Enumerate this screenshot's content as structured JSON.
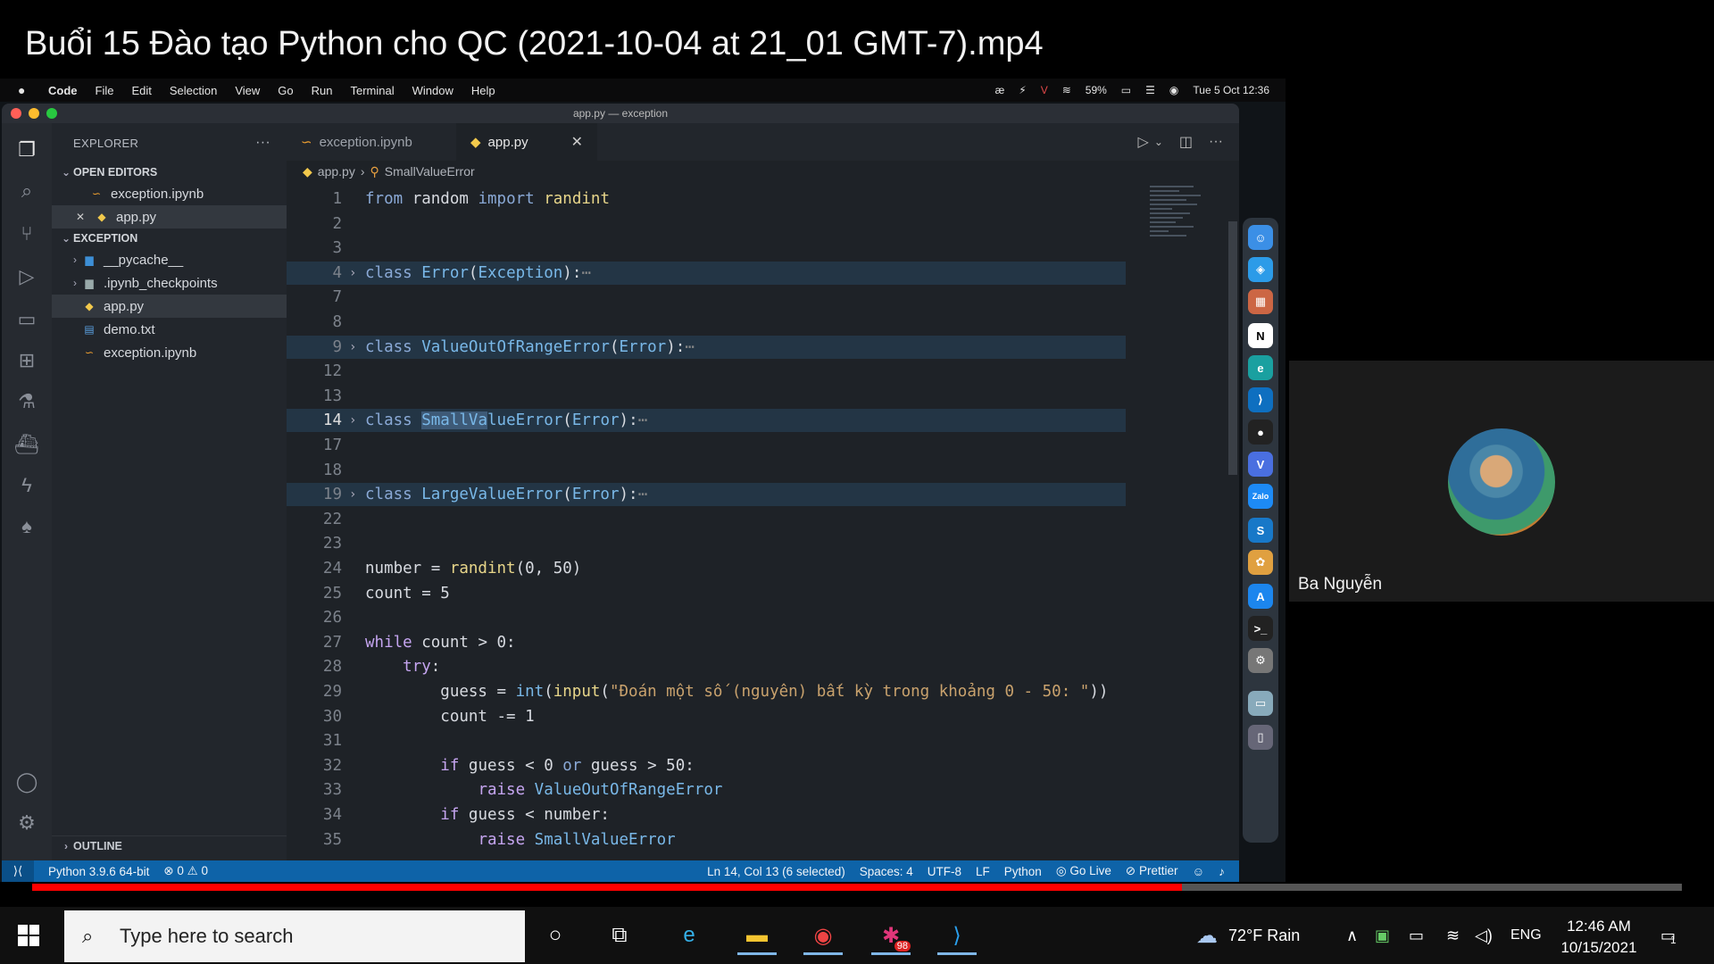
{
  "video": {
    "title": "Buổi 15 Đào tạo Python cho QC (2021-10-04 at 21_01 GMT-7).mp4",
    "progress_fraction": 0.697
  },
  "mac_menubar": {
    "apple": "",
    "app": "Code",
    "menus": [
      "File",
      "Edit",
      "Selection",
      "View",
      "Go",
      "Run",
      "Terminal",
      "Window",
      "Help"
    ],
    "battery": "59%",
    "datetime": "Tue 5 Oct  12:36"
  },
  "vscode": {
    "window_title": "app.py — exception",
    "explorer": {
      "header": "EXPLORER",
      "open_editors_label": "OPEN EDITORS",
      "open_editors": [
        "exception.ipynb",
        "app.py"
      ],
      "folder_label": "EXCEPTION",
      "tree": [
        "__pycache__",
        ".ipynb_checkpoints",
        "app.py",
        "demo.txt",
        "exception.ipynb"
      ],
      "outline_label": "OUTLINE"
    },
    "tabs": [
      "exception.ipynb",
      "app.py"
    ],
    "breadcrumb": [
      "app.py",
      "SmallValueError"
    ],
    "code_lines": [
      {
        "n": "1",
        "html": "<span class='kw'>from</span> <span class='txt'>random</span> <span class='kw'>import</span> <span class='fn'>randint</span>"
      },
      {
        "n": "2",
        "html": ""
      },
      {
        "n": "3",
        "html": ""
      },
      {
        "n": "4",
        "fold": true,
        "html": "<span class='kw'>class</span> <span class='cls'>Error</span>(<span class='cls'>Exception</span>):<span class='ell'>⋯</span>"
      },
      {
        "n": "7",
        "html": ""
      },
      {
        "n": "8",
        "html": ""
      },
      {
        "n": "9",
        "fold": true,
        "html": "<span class='kw'>class</span> <span class='cls'>ValueOutOfRangeError</span>(<span class='cls'>Error</span>):<span class='ell'>⋯</span>"
      },
      {
        "n": "12",
        "html": ""
      },
      {
        "n": "13",
        "html": ""
      },
      {
        "n": "14",
        "fold": true,
        "cur": true,
        "html": "<span class='kw'>class</span> <span class='cls'><span class='hl'>SmallVa</span>lueError</span>(<span class='cls'>Error</span>):<span class='ell'>⋯</span>"
      },
      {
        "n": "17",
        "html": ""
      },
      {
        "n": "18",
        "html": ""
      },
      {
        "n": "19",
        "fold": true,
        "html": "<span class='kw'>class</span> <span class='cls'>LargeValueError</span>(<span class='cls'>Error</span>):<span class='ell'>⋯</span>"
      },
      {
        "n": "22",
        "html": ""
      },
      {
        "n": "23",
        "html": ""
      },
      {
        "n": "24",
        "html": "number = <span class='fn'>randint</span>(0, 50)"
      },
      {
        "n": "25",
        "html": "count = 5"
      },
      {
        "n": "26",
        "html": ""
      },
      {
        "n": "27",
        "html": "<span class='kw2'>while</span> count &gt; 0:"
      },
      {
        "n": "28",
        "html": "    <span class='kw2'>try</span>:"
      },
      {
        "n": "29",
        "html": "        guess = <span class='cls'>int</span>(<span class='fn'>input</span>(<span class='str'>\"Đoán một số (nguyên) bất kỳ trong khoảng 0 - 50: \"</span>))"
      },
      {
        "n": "30",
        "html": "        count -= 1"
      },
      {
        "n": "31",
        "html": ""
      },
      {
        "n": "32",
        "html": "        <span class='kw2'>if</span> guess &lt; 0 <span class='kw'>or</span> guess &gt; 50:"
      },
      {
        "n": "33",
        "html": "            <span class='kw2'>raise</span> <span class='cls'>ValueOutOfRangeError</span>"
      },
      {
        "n": "34",
        "html": "        <span class='kw2'>if</span> guess &lt; number:"
      },
      {
        "n": "35",
        "html": "            <span class='kw2'>raise</span> <span class='cls'>SmallValueError</span>"
      }
    ],
    "status": {
      "python": "Python 3.9.6 64-bit",
      "problems": "⊗ 0 ⚠ 0",
      "position": "Ln 14, Col 13 (6 selected)",
      "spaces": "Spaces: 4",
      "encoding": "UTF-8",
      "eol": "LF",
      "language": "Python",
      "golive": "Go Live",
      "prettier": "Prettier"
    }
  },
  "participant": {
    "name": "Ba Nguyễn"
  },
  "taskbar": {
    "search_placeholder": "Type here to search",
    "weather": "72°F  Rain",
    "lang": "ENG",
    "time": "12:46 AM",
    "date": "10/15/2021",
    "slack_badge": "98",
    "notif_count": "1"
  },
  "colors": {
    "statusbar": "#0e63a8",
    "progress": "#ff0000",
    "fold_highlight": "#233545"
  }
}
